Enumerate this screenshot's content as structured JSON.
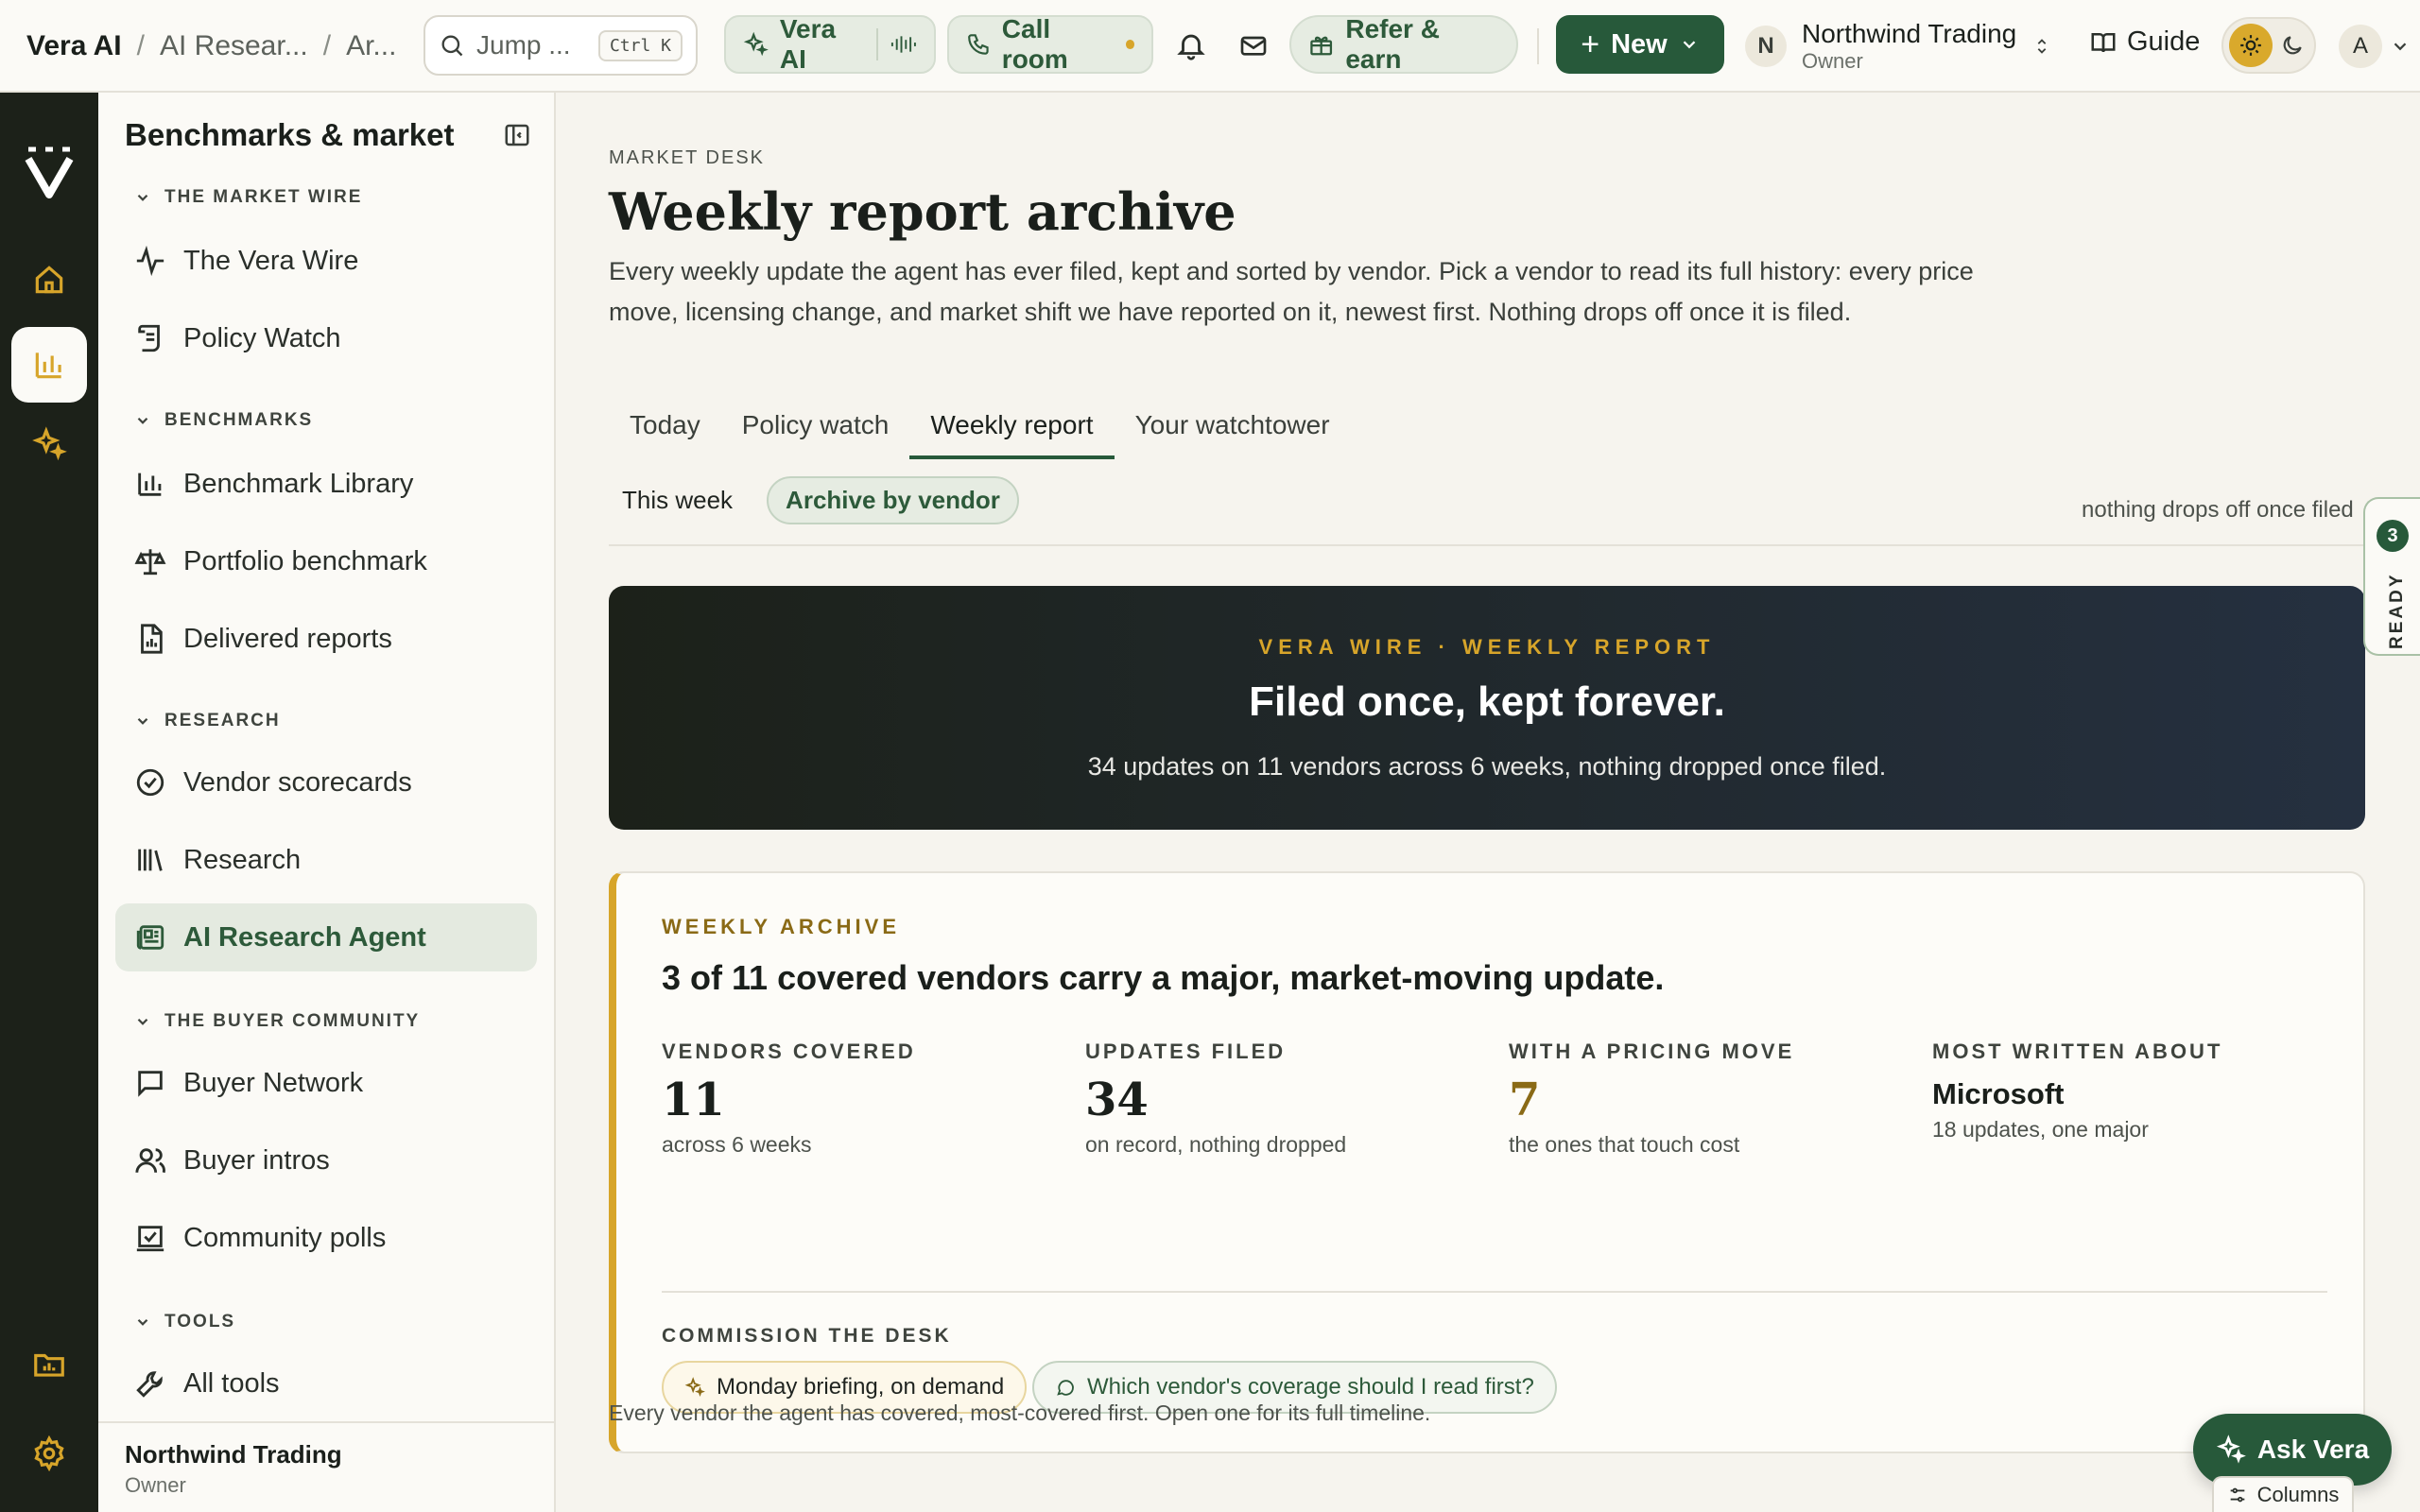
{
  "breadcrumb": [
    "Vera AI",
    "AI Resear...",
    "Ar..."
  ],
  "search": {
    "label": "Jump ...",
    "shortcut": "Ctrl K"
  },
  "topbar": {
    "vera_label": "Vera AI",
    "call_label": "Call room",
    "refer_label": "Refer & earn",
    "new_label": "New",
    "org_initial": "N",
    "org_name": "Northwind Trading",
    "org_role": "Owner",
    "guide_label": "Guide",
    "user_initial": "A"
  },
  "sidebar": {
    "title": "Benchmarks & market",
    "sections": [
      {
        "title": "THE MARKET WIRE",
        "items": [
          "The Vera Wire",
          "Policy Watch"
        ]
      },
      {
        "title": "BENCHMARKS",
        "items": [
          "Benchmark Library",
          "Portfolio benchmark",
          "Delivered reports"
        ]
      },
      {
        "title": "RESEARCH",
        "items": [
          "Vendor scorecards",
          "Research",
          "AI Research Agent"
        ]
      },
      {
        "title": "THE BUYER COMMUNITY",
        "items": [
          "Buyer Network",
          "Buyer intros",
          "Community polls"
        ]
      },
      {
        "title": "TOOLS",
        "items": [
          "All tools"
        ]
      }
    ],
    "footer_name": "Northwind Trading",
    "footer_role": "Owner"
  },
  "page": {
    "eyebrow": "MARKET DESK",
    "title": "Weekly report archive",
    "lead": "Every weekly update the agent has ever filed, kept and sorted by vendor. Pick a vendor to read its full history: every price move, licensing change, and market shift we have reported on it, newest first. Nothing drops off once it is filed.",
    "tabs": [
      "Today",
      "Policy watch",
      "Weekly report",
      "Your watchtower"
    ],
    "subtabs": [
      "This week",
      "Archive by vendor"
    ],
    "subnote": "nothing drops off once filed"
  },
  "hero": {
    "kicker": "VERA WIRE · WEEKLY REPORT",
    "title": "Filed once, kept forever.",
    "subtitle": "34 updates on 11 vendors across 6 weeks, nothing dropped once filed."
  },
  "archive": {
    "kicker": "WEEKLY ARCHIVE",
    "title": "3 of 11 covered vendors carry a major, market-moving update.",
    "stats": [
      {
        "label": "VENDORS COVERED",
        "value": "11",
        "desc": "across 6 weeks"
      },
      {
        "label": "UPDATES FILED",
        "value": "34",
        "desc": "on record, nothing dropped"
      },
      {
        "label": "WITH A PRICING MOVE",
        "value": "7",
        "desc": "the ones that touch cost"
      },
      {
        "label": "MOST WRITTEN ABOUT",
        "value": "Microsoft",
        "desc": "18 updates, one major"
      }
    ],
    "commission_label": "COMMISSION THE DESK",
    "chips": [
      "Monday briefing, on demand",
      "Which vendor's coverage should I read first?"
    ]
  },
  "footer_note": "Every vendor the agent has covered, most-covered first. Open one for its full timeline.",
  "ready": {
    "count": "3",
    "label": "READY"
  },
  "ask_label": "Ask Vera",
  "columns_label": "Columns",
  "colors": {
    "accent": "#27593a",
    "gold": "#d7a52a",
    "rail": "#1c2119"
  }
}
